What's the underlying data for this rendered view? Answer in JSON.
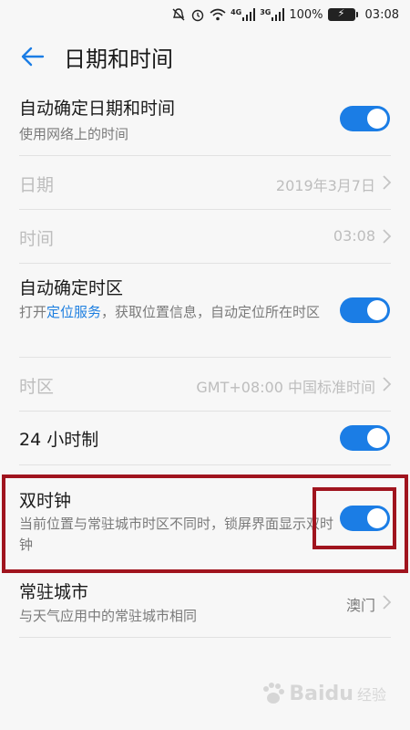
{
  "status_bar": {
    "network_badges": [
      "4G",
      "3G"
    ],
    "battery_percent": "100%",
    "time": "03:08",
    "icons": [
      "mute-icon",
      "alarm-icon",
      "wifi-icon",
      "signal-icon",
      "signal-icon",
      "battery-charging-icon"
    ]
  },
  "header": {
    "back_icon": "back-arrow-icon",
    "title": "日期和时间"
  },
  "settings": {
    "auto_datetime": {
      "label": "自动确定日期和时间",
      "subtitle": "使用网络上的时间",
      "enabled": true
    },
    "date": {
      "label": "日期",
      "value": "2019年3月7日"
    },
    "time": {
      "label": "时间",
      "value": "03:08"
    },
    "auto_timezone": {
      "label": "自动确定时区",
      "subtitle_prefix": "打开",
      "subtitle_link": "定位服务",
      "subtitle_suffix": "，获取位置信息，自动定位所在时区",
      "enabled": true
    },
    "timezone": {
      "label": "时区",
      "value": "GMT+08:00 中国标准时间"
    },
    "hour24": {
      "label": "24 小时制",
      "enabled": true
    },
    "dual_clock": {
      "label": "双时钟",
      "subtitle": "当前位置与常驻城市时区不同时，锁屏界面显示双时钟",
      "enabled": true
    },
    "home_city": {
      "label": "常驻城市",
      "subtitle": "与天气应用中的常驻城市相同",
      "value": "澳门"
    }
  },
  "colors": {
    "accent": "#1b7de5",
    "link": "#1e7fe0",
    "annotation_red": "#a0141e",
    "background": "#f7f7f7"
  },
  "watermark": {
    "brand": "Baidu",
    "sub": "经验"
  }
}
